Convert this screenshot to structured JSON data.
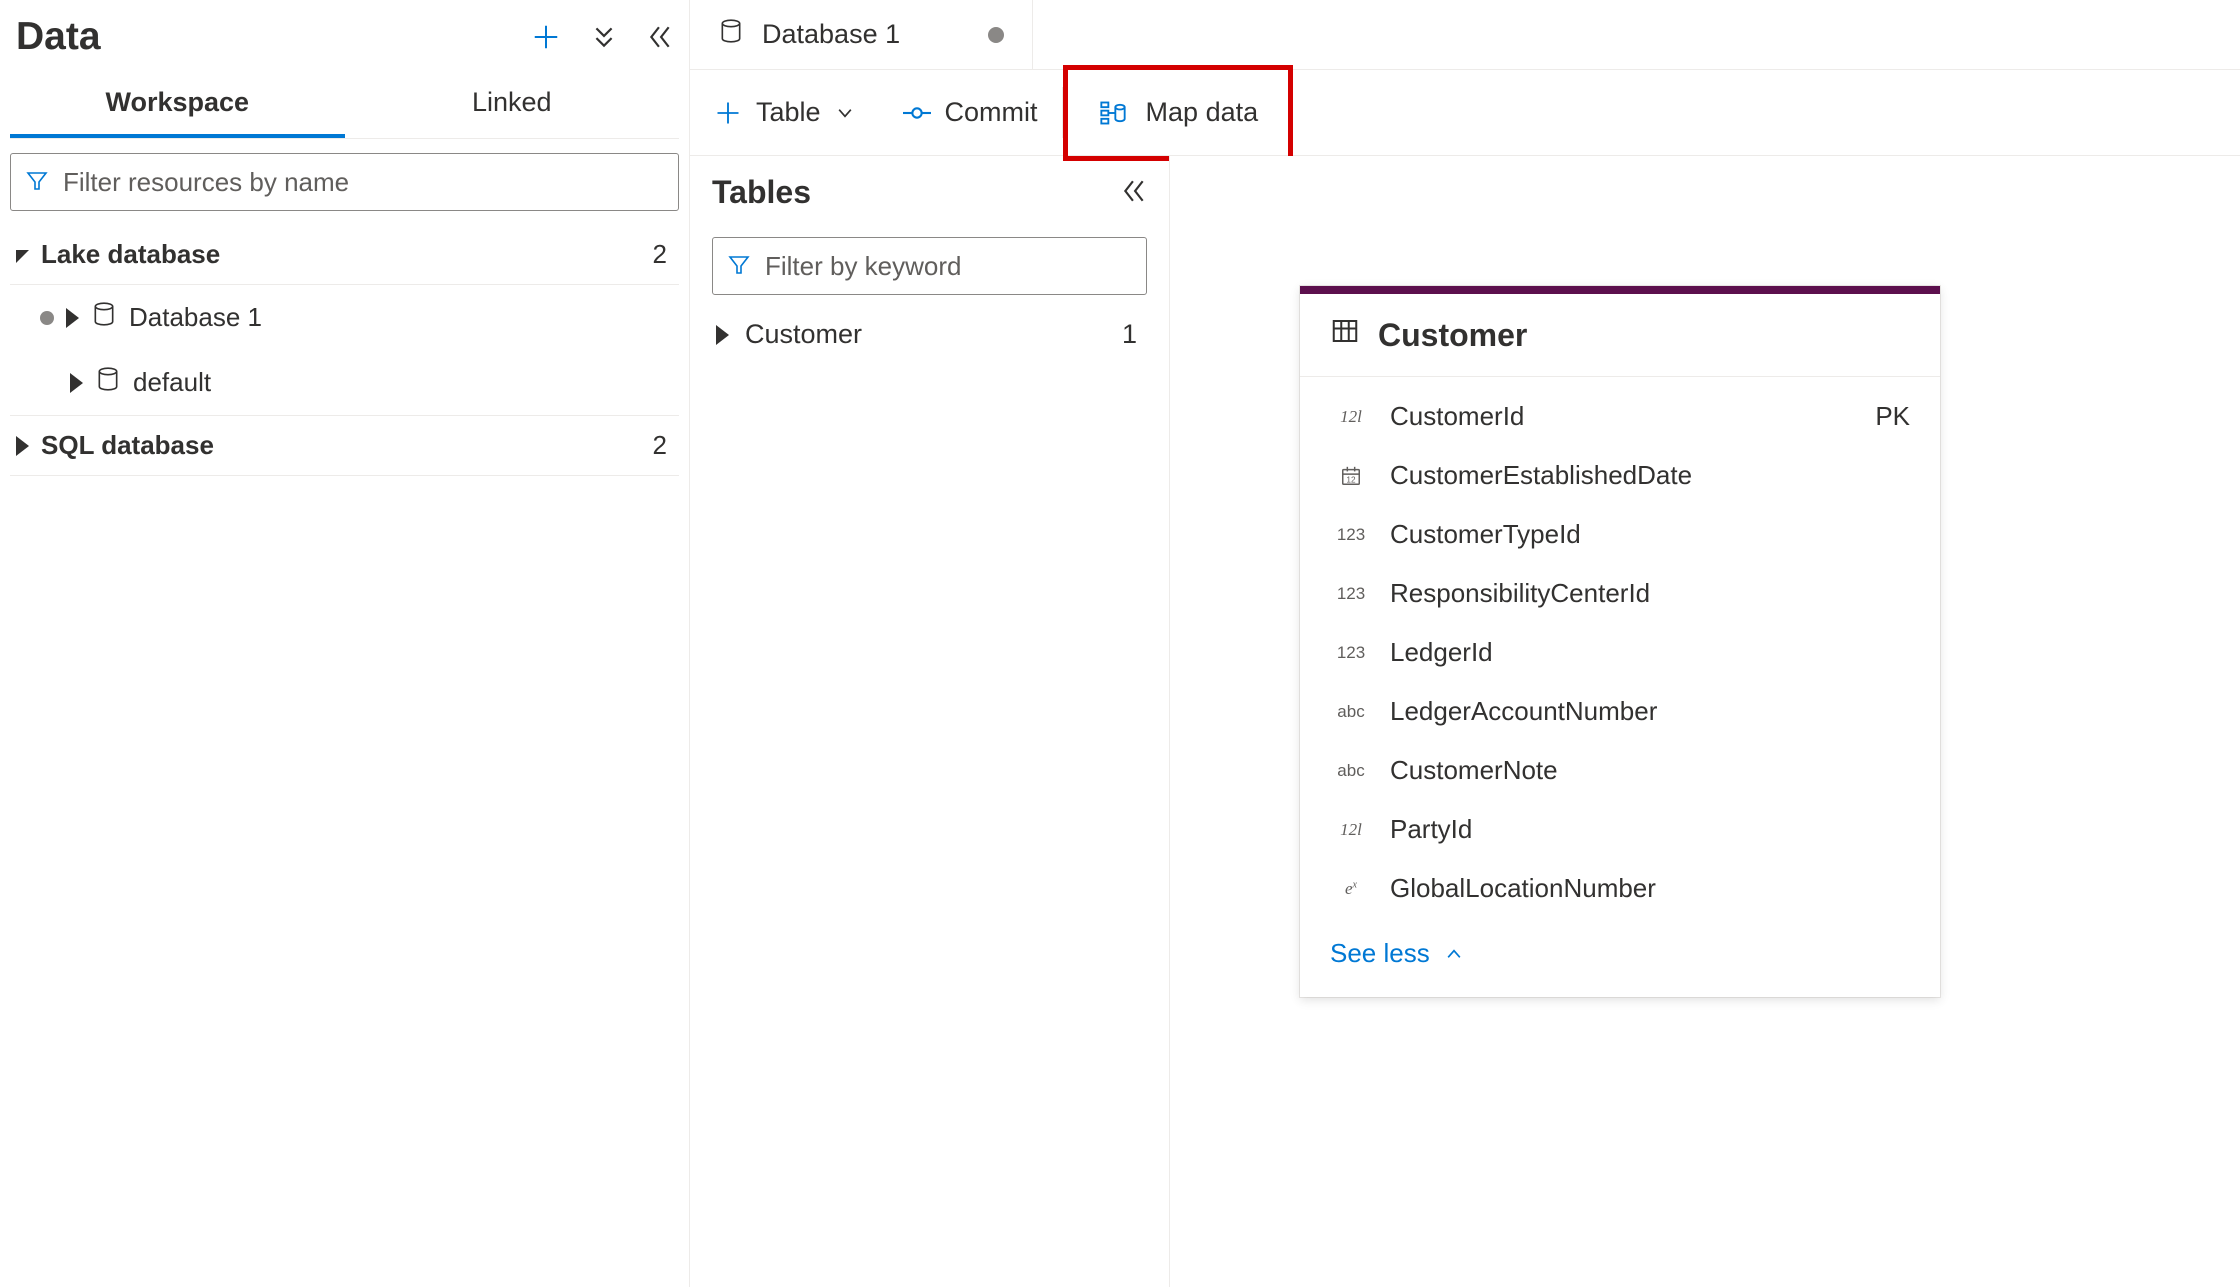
{
  "sidebar": {
    "title": "Data",
    "tabs": {
      "workspace": "Workspace",
      "linked": "Linked"
    },
    "filter_placeholder": "Filter resources by name",
    "groups": {
      "lake": {
        "label": "Lake database",
        "count": "2"
      },
      "sql": {
        "label": "SQL database",
        "count": "2"
      }
    },
    "items": {
      "db1": "Database 1",
      "default": "default"
    }
  },
  "editor": {
    "tab_label": "Database 1",
    "toolbar": {
      "table": "Table",
      "commit": "Commit",
      "mapdata": "Map data"
    }
  },
  "tablesPanel": {
    "title": "Tables",
    "filter_placeholder": "Filter by keyword",
    "entry": {
      "name": "Customer",
      "count": "1"
    }
  },
  "card": {
    "title": "Customer",
    "fields": [
      {
        "type": "12l",
        "name": "CustomerId",
        "suffix": "PK"
      },
      {
        "type": "cal",
        "name": "CustomerEstablishedDate",
        "suffix": ""
      },
      {
        "type": "123",
        "name": "CustomerTypeId",
        "suffix": ""
      },
      {
        "type": "123",
        "name": "ResponsibilityCenterId",
        "suffix": ""
      },
      {
        "type": "123",
        "name": "LedgerId",
        "suffix": ""
      },
      {
        "type": "abc",
        "name": "LedgerAccountNumber",
        "suffix": ""
      },
      {
        "type": "abc",
        "name": "CustomerNote",
        "suffix": ""
      },
      {
        "type": "12l",
        "name": "PartyId",
        "suffix": ""
      },
      {
        "type": "ex",
        "name": "GlobalLocationNumber",
        "suffix": ""
      }
    ],
    "see_less": "See less"
  }
}
